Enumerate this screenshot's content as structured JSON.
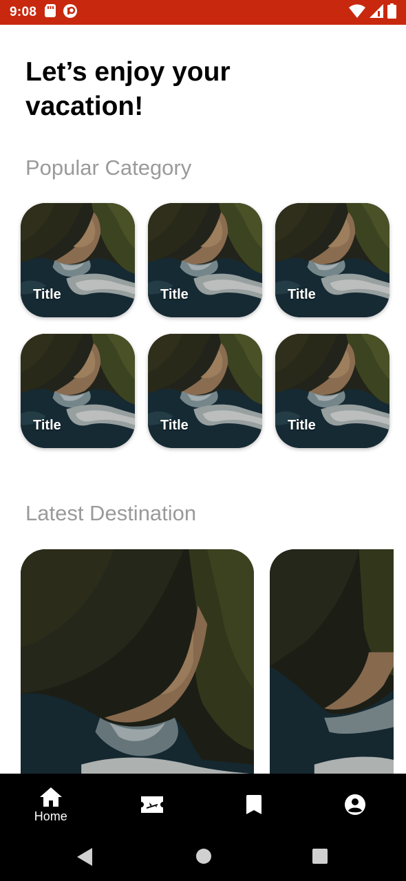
{
  "status_bar": {
    "time": "9:08",
    "left_icons": [
      "sd-card-icon",
      "app-notification-icon"
    ],
    "right_icons": [
      "wifi-icon",
      "cellular-signal-icon",
      "battery-icon"
    ],
    "background_color": "#c8290e"
  },
  "main": {
    "headline": "Let’s enjoy your vacation!",
    "popular_section_title": "Popular Category",
    "categories": [
      {
        "title": "Title"
      },
      {
        "title": "Title"
      },
      {
        "title": "Title"
      },
      {
        "title": "Title"
      },
      {
        "title": "Title"
      },
      {
        "title": "Title"
      }
    ],
    "latest_section_title": "Latest Destination"
  },
  "bottom_nav": {
    "items": [
      {
        "icon": "home-icon",
        "label": "Home",
        "active": true
      },
      {
        "icon": "flight-ticket-icon",
        "label": ""
      },
      {
        "icon": "bookmark-icon",
        "label": ""
      },
      {
        "icon": "account-circle-icon",
        "label": ""
      }
    ]
  },
  "system_nav": {
    "buttons": [
      "back-icon",
      "home-circle-icon",
      "recents-icon"
    ]
  }
}
